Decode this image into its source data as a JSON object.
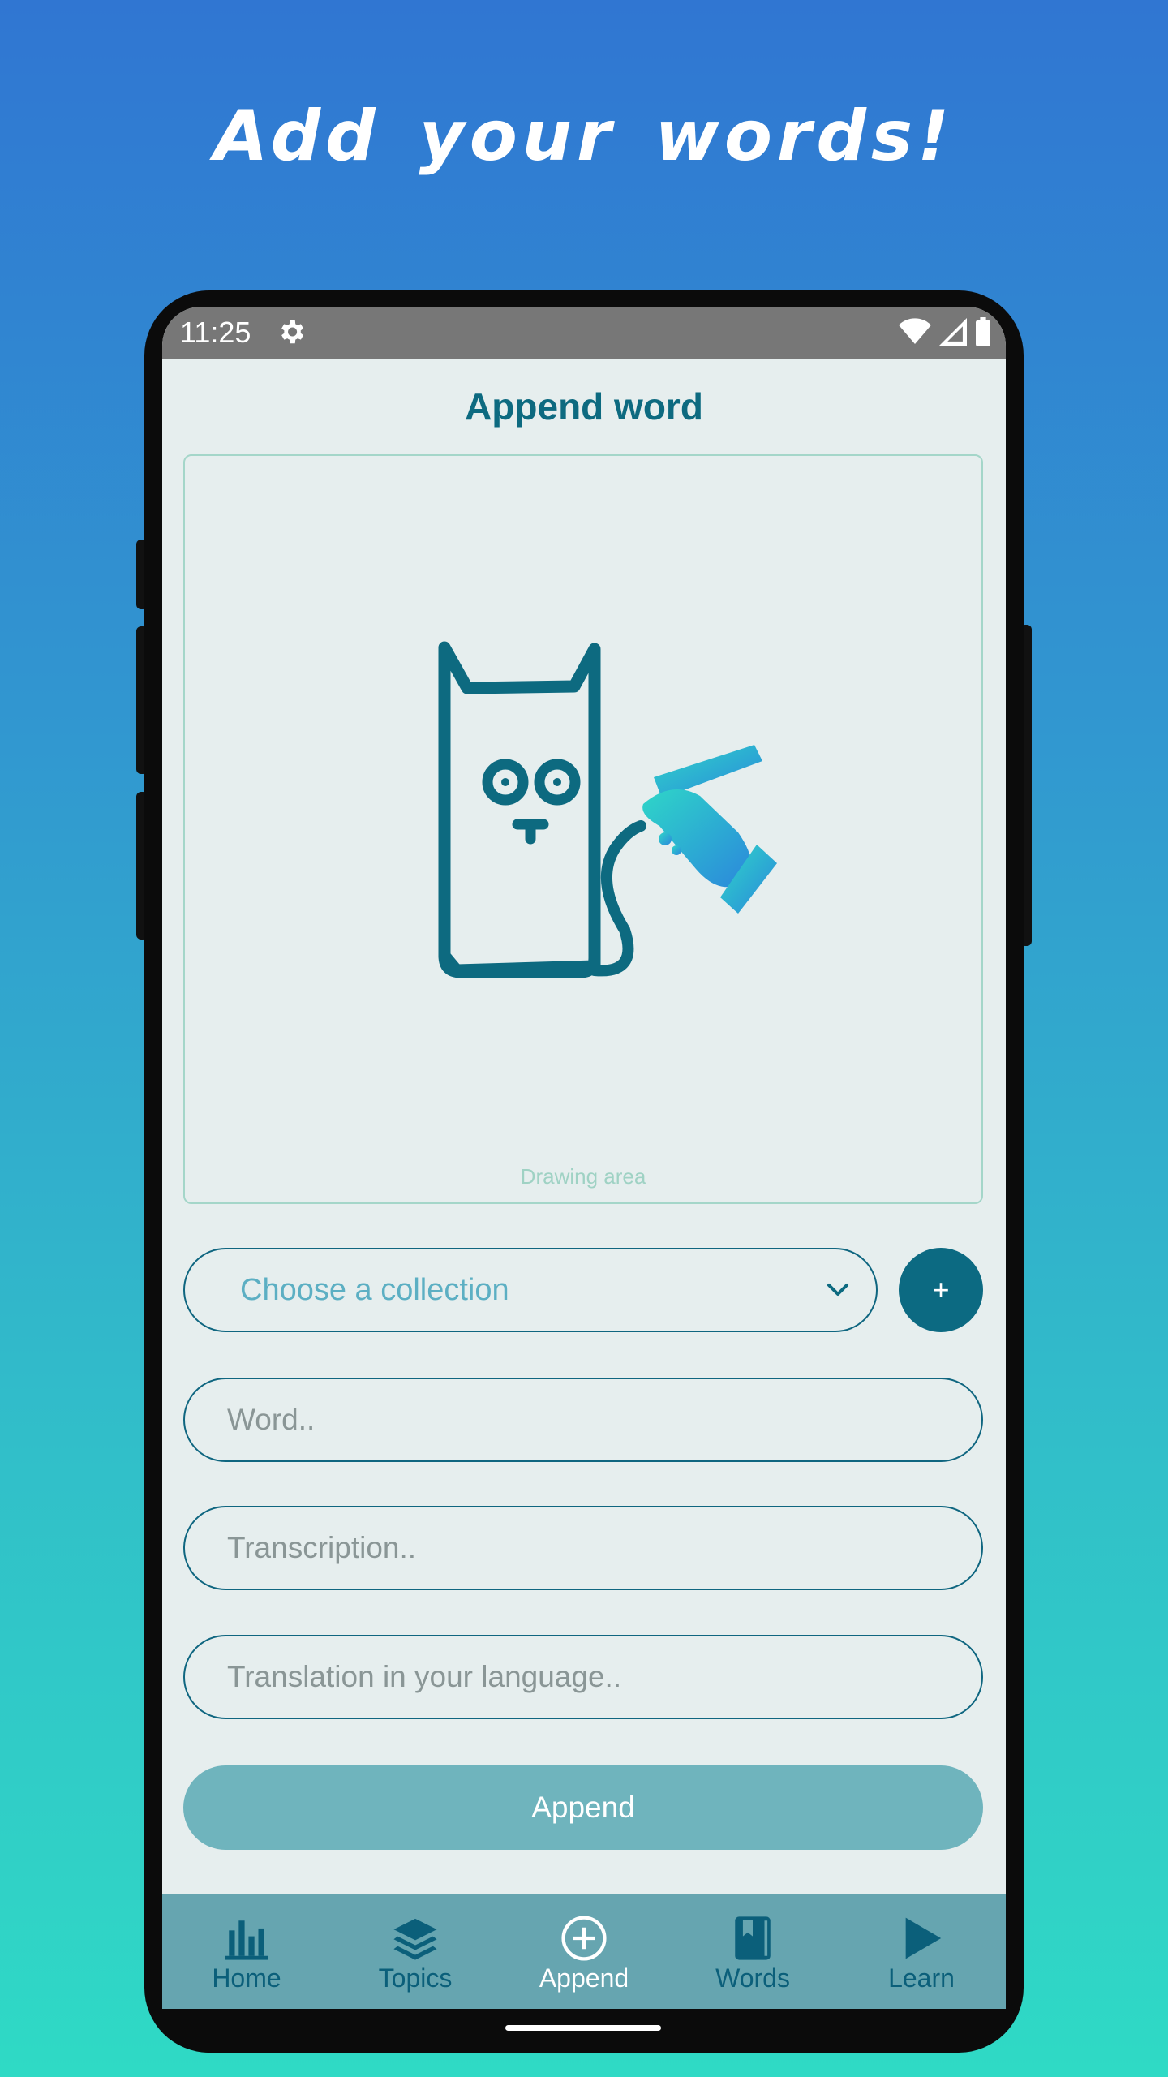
{
  "promo": {
    "headline": "Add your words!"
  },
  "status_bar": {
    "time": "11:25",
    "icons": [
      "gear-icon",
      "wifi-icon",
      "signal-icon",
      "battery-icon"
    ]
  },
  "header": {
    "title": "Append word"
  },
  "drawing": {
    "label": "Drawing area",
    "illustration": "cat-drawing-icon"
  },
  "collection": {
    "placeholder": "Choose a collection",
    "add_label": "+"
  },
  "form": {
    "word_placeholder": "Word..",
    "transcription_placeholder": "Transcription..",
    "translation_placeholder": "Translation in your language..",
    "append_label": "Append"
  },
  "nav": {
    "items": [
      {
        "label": "Home",
        "icon": "bar-chart-icon"
      },
      {
        "label": "Topics",
        "icon": "layers-icon"
      },
      {
        "label": "Append",
        "icon": "plus-circle-icon",
        "active": true
      },
      {
        "label": "Words",
        "icon": "book-icon"
      },
      {
        "label": "Learn",
        "icon": "play-icon"
      }
    ]
  },
  "colors": {
    "primary": "#0c6a82",
    "screen_bg": "#e6eeee",
    "nav_bg": "#66a5b0",
    "append_button": "#6fb4bd",
    "drawing_border": "#a4d6c9"
  }
}
